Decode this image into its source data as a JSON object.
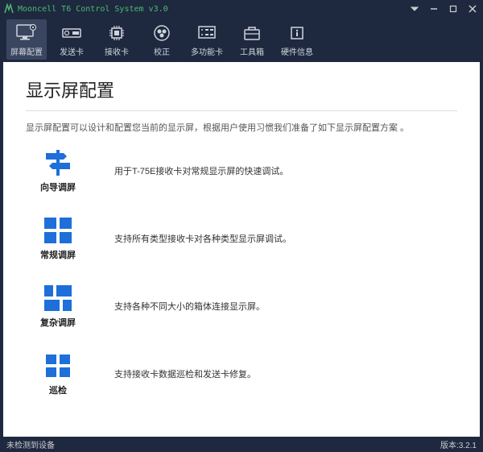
{
  "title": "Mooncell T6 Control System v3.0",
  "toolbar": {
    "items": [
      {
        "label": "屏幕配置"
      },
      {
        "label": "发送卡"
      },
      {
        "label": "接收卡"
      },
      {
        "label": "校正"
      },
      {
        "label": "多功能卡"
      },
      {
        "label": "工具箱"
      },
      {
        "label": "硬件信息"
      }
    ]
  },
  "content": {
    "heading": "显示屏配置",
    "description": "显示屏配置可以设计和配置您当前的显示屏，根据用户使用习惯我们准备了如下显示屏配置方案 。",
    "options": [
      {
        "label": "向导调屏",
        "desc": "用于T-75E接收卡对常规显示屏的快速调试。"
      },
      {
        "label": "常规调屏",
        "desc": "支持所有类型接收卡对各种类型显示屏调试。"
      },
      {
        "label": "复杂调屏",
        "desc": "支持各种不同大小的箱体连接显示屏。"
      },
      {
        "label": "巡检",
        "desc": "支持接收卡数据巡检和发送卡修复。"
      }
    ]
  },
  "status": {
    "left": "未检测到设备",
    "right": "版本:3.2.1"
  }
}
